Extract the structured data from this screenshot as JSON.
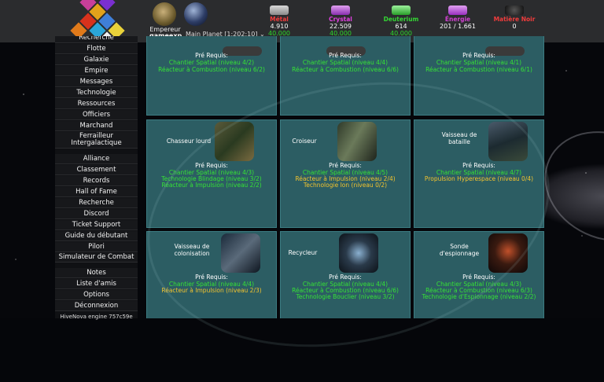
{
  "header": {
    "rank": "Empereur",
    "player": "gameexp",
    "planet": "Main Planet [1:202:10]",
    "planet_chevron": "⌄",
    "resources": [
      {
        "name": "Métal",
        "amount": "4.910",
        "production": "40.000",
        "color": "#f03c3c",
        "icon": "metal-icon"
      },
      {
        "name": "Crystal",
        "amount": "22.509",
        "production": "40.000",
        "color": "#e040e0",
        "icon": "crystal-icon"
      },
      {
        "name": "Deuterium",
        "amount": "614",
        "production": "40.000",
        "color": "#34d634",
        "icon": "deuterium-icon"
      },
      {
        "name": "Énergie",
        "amount": "201 / 1.661",
        "production": "",
        "color": "#d040d0",
        "icon": "energy-icon"
      },
      {
        "name": "Matière Noir",
        "amount": "0",
        "production": "",
        "color": "#f03c3c",
        "icon": "dark-matter-icon"
      }
    ]
  },
  "sidebar": {
    "group1": [
      "Recherche",
      "Flotte",
      "Galaxie",
      "Empire",
      "Messages",
      "Technologie",
      "Ressources",
      "Officiers",
      "Marchand",
      "Ferrailleur Intergalactique"
    ],
    "group2": [
      "Alliance",
      "Classement",
      "Records",
      "Hall of Fame",
      "Recherche",
      "Discord",
      "Ticket Support",
      "Guide du débutant",
      "Pilori",
      "Simulateur de Combat"
    ],
    "group3": [
      "Notes",
      "Liste d'amis",
      "Options",
      "Déconnexion"
    ],
    "version": "HiveNova engine 757c59e"
  },
  "cards": {
    "prereq_label": "Pré Requis:",
    "top": [
      {
        "reqs": [
          {
            "t": "Chantier Spatial (niveau 4/2)",
            "ok": true
          },
          {
            "t": "Réacteur à Combustion (niveau 6/2)",
            "ok": true
          }
        ]
      },
      {
        "reqs": [
          {
            "t": "Chantier Spatial (niveau 4/4)",
            "ok": true
          },
          {
            "t": "Réacteur à Combustion (niveau 6/6)",
            "ok": true
          }
        ]
      },
      {
        "reqs": [
          {
            "t": "Chantier Spatial (niveau 4/1)",
            "ok": true
          },
          {
            "t": "Réacteur à Combustion (niveau 6/1)",
            "ok": true
          }
        ]
      }
    ],
    "middle": [
      {
        "title": "Chasseur lourd",
        "reqs": [
          {
            "t": "Chantier Spatial (niveau 4/3)",
            "ok": true
          },
          {
            "t": "Technologie Blindage (niveau 3/2)",
            "ok": true
          },
          {
            "t": "Réacteur à Impulsion (niveau 2/2)",
            "ok": true
          }
        ]
      },
      {
        "title": "Croiseur",
        "reqs": [
          {
            "t": "Chantier Spatial (niveau 4/5)",
            "ok": true
          },
          {
            "t": "Réacteur à Impulsion (niveau 2/4)",
            "ok": false
          },
          {
            "t": "Technologie Ion (niveau 0/2)",
            "ok": false
          }
        ]
      },
      {
        "title": "Vaisseau de bataille",
        "reqs": [
          {
            "t": "Chantier Spatial (niveau 4/7)",
            "ok": true
          },
          {
            "t": "Propulsion Hyperespace (niveau 0/4)",
            "ok": false
          }
        ]
      }
    ],
    "bottom": [
      {
        "title": "Vaisseau de colonisation",
        "reqs": [
          {
            "t": "Chantier Spatial (niveau 4/4)",
            "ok": true
          },
          {
            "t": "Réacteur à Impulsion (niveau 2/3)",
            "ok": false
          }
        ]
      },
      {
        "title": "Recycleur",
        "reqs": [
          {
            "t": "Chantier Spatial (niveau 4/4)",
            "ok": true
          },
          {
            "t": "Réacteur à Combustion (niveau 6/6)",
            "ok": true
          },
          {
            "t": "Technologie Bouclier (niveau 3/2)",
            "ok": true
          }
        ]
      },
      {
        "title": "Sonde d'espionnage",
        "reqs": [
          {
            "t": "Chantier Spatial (niveau 4/3)",
            "ok": true
          },
          {
            "t": "Réacteur à Combustion (niveau 6/3)",
            "ok": true
          },
          {
            "t": "Technologie d'Espionnage (niveau 2/2)",
            "ok": true
          }
        ]
      }
    ]
  }
}
